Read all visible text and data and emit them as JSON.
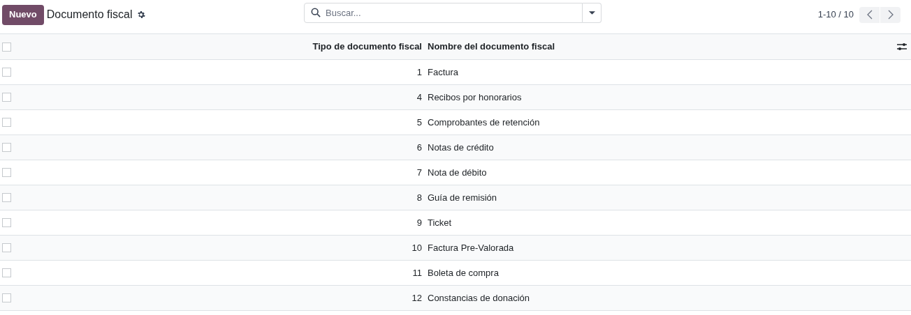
{
  "toolbar": {
    "new_button": "Nuevo",
    "title": "Documento fiscal",
    "search": {
      "placeholder": "Buscar..."
    },
    "pager": "1-10 / 10"
  },
  "table": {
    "select_all_checked": false,
    "columns": [
      "Tipo de documento fiscal",
      "Nombre del documento fiscal"
    ],
    "rows": [
      {
        "type": "1",
        "name": "Factura",
        "checked": false
      },
      {
        "type": "4",
        "name": "Recibos por honorarios",
        "checked": false
      },
      {
        "type": "5",
        "name": "Comprobantes de retención",
        "checked": false
      },
      {
        "type": "6",
        "name": "Notas de crédito",
        "checked": false
      },
      {
        "type": "7",
        "name": "Nota de débito",
        "checked": false
      },
      {
        "type": "8",
        "name": "Guía de remisión",
        "checked": false
      },
      {
        "type": "9",
        "name": "Ticket",
        "checked": false
      },
      {
        "type": "10",
        "name": "Factura Pre-Valorada",
        "checked": false
      },
      {
        "type": "11",
        "name": "Boleta de compra",
        "checked": false
      },
      {
        "type": "12",
        "name": "Constancias de donación",
        "checked": false
      }
    ]
  }
}
